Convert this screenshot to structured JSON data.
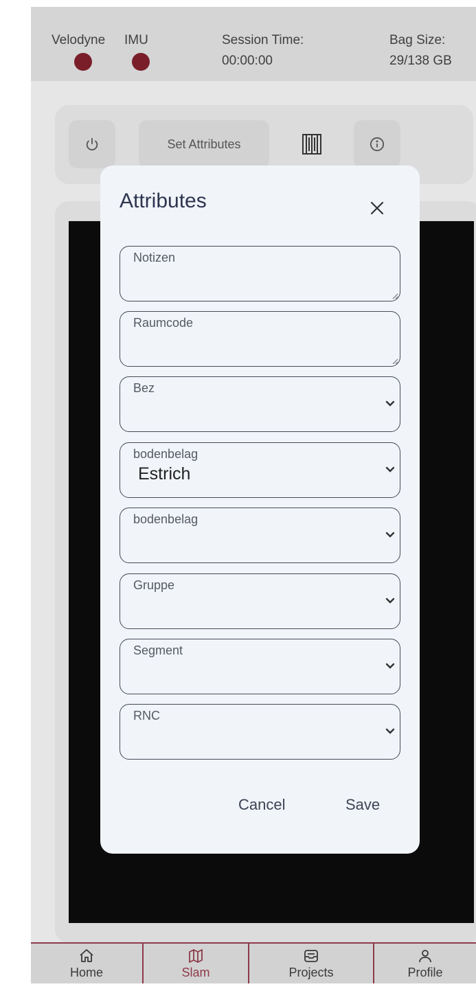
{
  "topbar": {
    "sensors": [
      {
        "label": "Velodyne",
        "status_color": "#7a1f2a"
      },
      {
        "label": "IMU",
        "status_color": "#7a1f2a"
      }
    ],
    "session_time": {
      "label": "Session Time:",
      "value": "00:00:00"
    },
    "bag_size": {
      "label": "Bag Size:",
      "value": "29/138 GB"
    }
  },
  "toolbar": {
    "power_icon": "power-icon",
    "set_attributes_label": "Set Attributes",
    "barcode_icon": "barcode-icon",
    "info_icon": "info-icon"
  },
  "modal": {
    "title": "Attributes",
    "fields": [
      {
        "label": "Notizen",
        "type": "textarea",
        "value": ""
      },
      {
        "label": "Raumcode",
        "type": "textarea",
        "value": ""
      },
      {
        "label": "Bez",
        "type": "select",
        "value": ""
      },
      {
        "label": "bodenbelag",
        "type": "select",
        "value": "Estrich"
      },
      {
        "label": "bodenbelag",
        "type": "select",
        "value": ""
      },
      {
        "label": "Gruppe",
        "type": "select",
        "value": ""
      },
      {
        "label": "Segment",
        "type": "select",
        "value": ""
      },
      {
        "label": "RNC",
        "type": "select",
        "value": ""
      }
    ],
    "cancel_label": "Cancel",
    "save_label": "Save"
  },
  "tabs": [
    {
      "label": "Home",
      "icon": "home-icon",
      "active": false
    },
    {
      "label": "Slam",
      "icon": "map-icon",
      "active": true
    },
    {
      "label": "Projects",
      "icon": "inbox-icon",
      "active": false
    },
    {
      "label": "Profile",
      "icon": "user-icon",
      "active": false
    }
  ],
  "colors": {
    "accent": "#8e3a49",
    "status_off": "#7a1f2a",
    "modal_bg": "#f1f4f9"
  }
}
